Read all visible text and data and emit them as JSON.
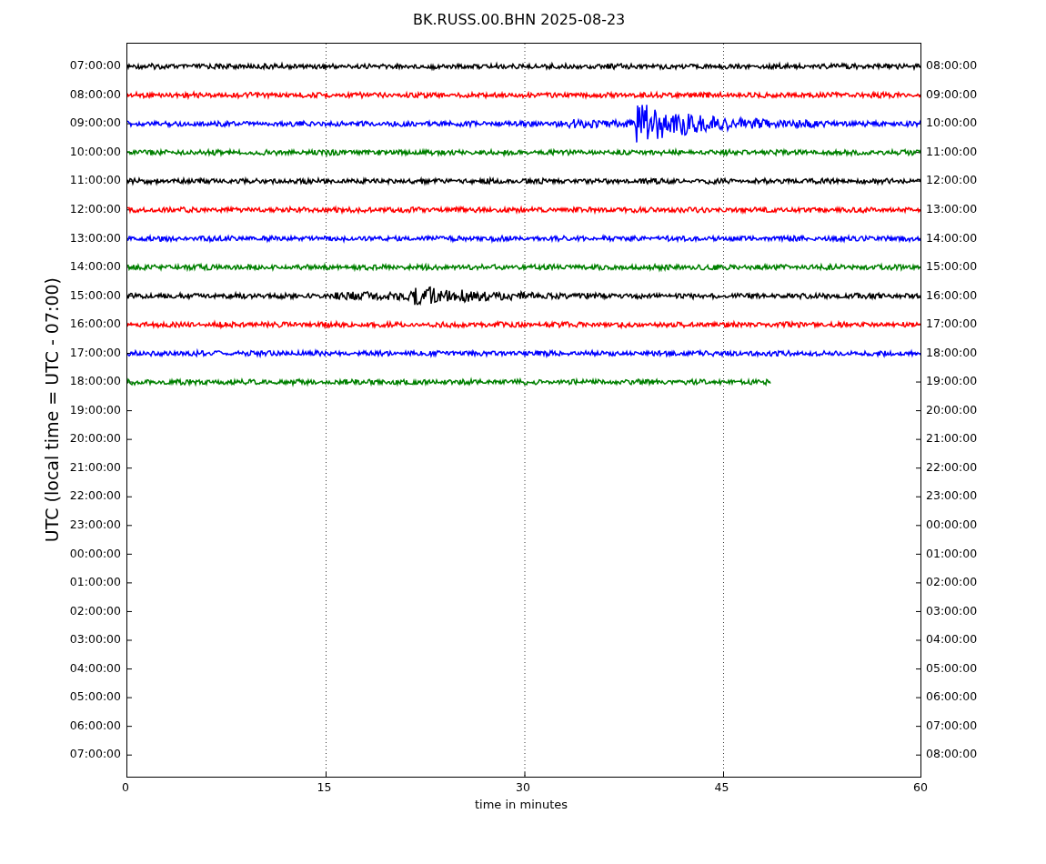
{
  "title": "BK.RUSS.00.BHN 2025-08-23",
  "ylabel": "UTC (local time = UTC - 07:00)",
  "xlabel": "time in minutes",
  "xticks": [
    "0",
    "15",
    "30",
    "45",
    "60"
  ],
  "left_labels": [
    "07:00:00",
    "08:00:00",
    "09:00:00",
    "10:00:00",
    "11:00:00",
    "12:00:00",
    "13:00:00",
    "14:00:00",
    "15:00:00",
    "16:00:00",
    "17:00:00",
    "18:00:00",
    "19:00:00",
    "20:00:00",
    "21:00:00",
    "22:00:00",
    "23:00:00",
    "00:00:00",
    "01:00:00",
    "02:00:00",
    "03:00:00",
    "04:00:00",
    "05:00:00",
    "06:00:00",
    "07:00:00"
  ],
  "right_labels": [
    "08:00:00",
    "09:00:00",
    "10:00:00",
    "11:00:00",
    "12:00:00",
    "13:00:00",
    "14:00:00",
    "15:00:00",
    "16:00:00",
    "17:00:00",
    "18:00:00",
    "19:00:00",
    "20:00:00",
    "21:00:00",
    "22:00:00",
    "23:00:00",
    "00:00:00",
    "01:00:00",
    "02:00:00",
    "03:00:00",
    "04:00:00",
    "05:00:00",
    "06:00:00",
    "07:00:00",
    "08:00:00"
  ],
  "traces": [
    {
      "color": "#000000",
      "event": false,
      "partial": false
    },
    {
      "color": "#ff0000",
      "event": false,
      "partial": false
    },
    {
      "color": "#0000ff",
      "event": true,
      "partial": false
    },
    {
      "color": "#008000",
      "event": false,
      "partial": false
    },
    {
      "color": "#000000",
      "event": false,
      "partial": false
    },
    {
      "color": "#ff0000",
      "event": false,
      "partial": false
    },
    {
      "color": "#0000ff",
      "event": false,
      "partial": false
    },
    {
      "color": "#008000",
      "event": false,
      "partial": false
    },
    {
      "color": "#000000",
      "event": true,
      "partial": false
    },
    {
      "color": "#ff0000",
      "event": false,
      "partial": false
    },
    {
      "color": "#0000ff",
      "event": false,
      "partial": false
    },
    {
      "color": "#008000",
      "event": false,
      "partial": true
    }
  ]
}
